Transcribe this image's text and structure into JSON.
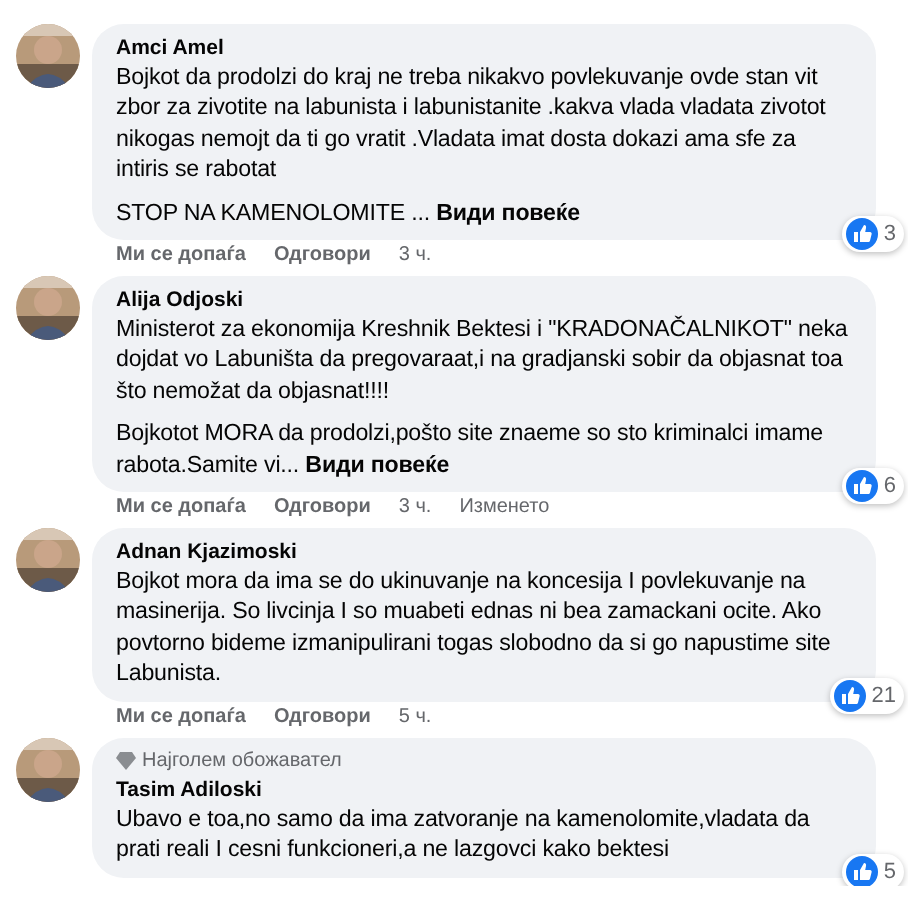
{
  "comments": [
    {
      "author": "Amci Amel",
      "paragraphs": [
        "Bojkot da prodolzi do kraj ne treba nikakvo povlekuvanje ovde stan vit zbor za zivotite na labunista i labunistanite .kakva vlada vladata zivotot nikogas nemojt da ti go vratit .Vladata imat dosta dokazi ama sfe za intiris se rabotat",
        "STOP NA KAMENOLOMITE ..."
      ],
      "see_more": "Види повеќе",
      "reactions": "3",
      "actions": {
        "like": "Ми се допаѓа",
        "reply": "Одговори",
        "time": "3 ч."
      }
    },
    {
      "author": "Alija Odjoski",
      "paragraphs": [
        "Ministerot za ekonomija Kreshnik Bektesi i \"KRADONAČALNIKOT\" neka dojdat vo Labuništa da pregovaraat,i na gradjanski sobir da objasnat toa što nemožat da objasnat!!!!",
        "Bojkotot MORA da prodolzi,pošto site znaeme so sto kriminalci imame rabota.Samite vi..."
      ],
      "see_more": "Види повеќе",
      "reactions": "6",
      "actions": {
        "like": "Ми се допаѓа",
        "reply": "Одговори",
        "time": "3 ч.",
        "edited": "Изменето"
      }
    },
    {
      "author": "Adnan Kjazimoski",
      "paragraphs": [
        "Bojkot mora da ima se do ukinuvanje na koncesija I povlekuvanje na masinerija. So livcinja I so muabeti ednas ni bea zamackani ocite. Ako povtorno bideme izmanipulirani togas slobodno da si go napustime site Labunista."
      ],
      "reactions": "21",
      "actions": {
        "like": "Ми се допаѓа",
        "reply": "Одговори",
        "time": "5 ч."
      }
    },
    {
      "badge": "Најголем обожавател",
      "author": "Tasim Adiloski",
      "paragraphs": [
        "Ubavo e toa,no samo da ima zatvoranje na kamenolomite,vladata da prati reali I cesni funkcioneri,a ne lazgovci kako bektesi"
      ],
      "reactions": "5"
    }
  ]
}
